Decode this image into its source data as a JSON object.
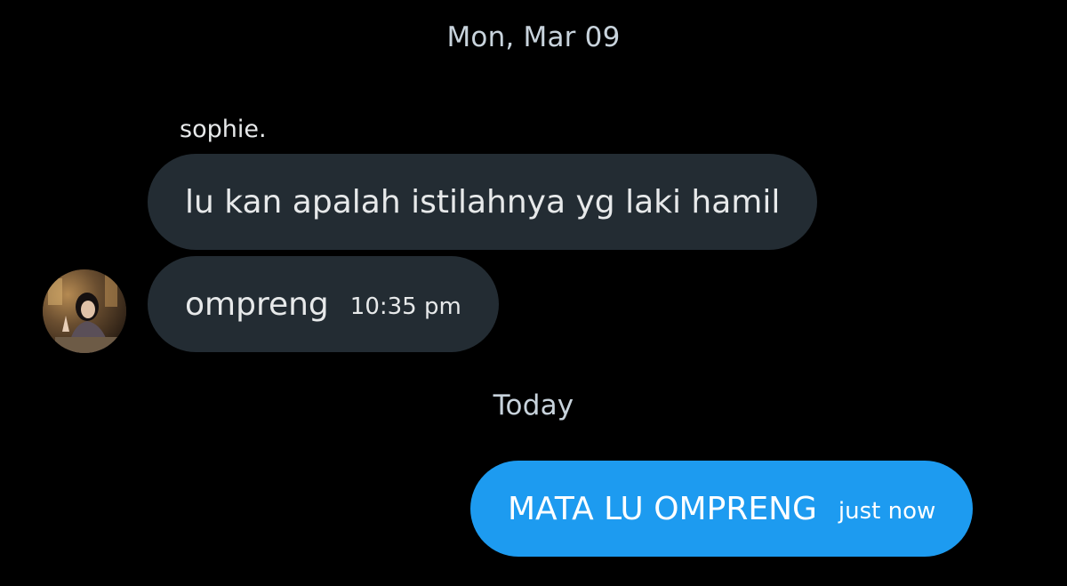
{
  "conversation": {
    "separators": [
      "Mon, Mar 09",
      "Today"
    ],
    "sender_name": "sophie.",
    "messages": [
      {
        "text": "lu kan apalah istilahnya yg laki hamil",
        "time": "",
        "direction": "incoming"
      },
      {
        "text": "ompreng",
        "time": "10:35 pm",
        "direction": "incoming"
      },
      {
        "text": "MATA LU OMPRENG",
        "time": "just now",
        "direction": "outgoing"
      }
    ]
  },
  "colors": {
    "background": "#000000",
    "incoming_bubble": "#232c33",
    "outgoing_bubble": "#1d9bf0",
    "separator_text": "#c8d3dc"
  },
  "icons": {
    "avatar": "user-avatar-photo"
  }
}
